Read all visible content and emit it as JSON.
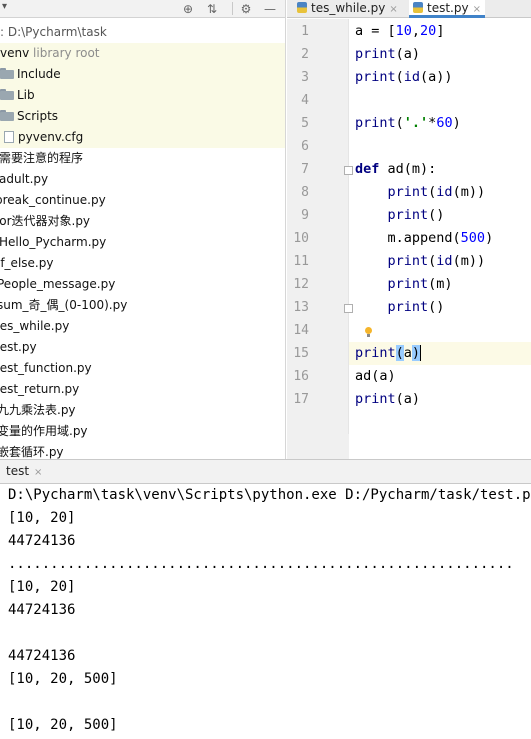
{
  "project": {
    "toolbar": {
      "dropdown_arrow": "▾"
    },
    "tree": [
      {
        "text": "D:\\Pycharm\\task",
        "kind": "path"
      },
      {
        "text": "venv",
        "muted": "library root",
        "kind": "venv"
      },
      {
        "text": "Include",
        "kind": "folder"
      },
      {
        "text": "Lib",
        "kind": "folder"
      },
      {
        "text": "Scripts",
        "kind": "folder"
      },
      {
        "text": "pyvenv.cfg",
        "kind": "file"
      },
      {
        "text": "需要注意的程序",
        "kind": "item"
      },
      {
        "text": "adult.py",
        "kind": "item"
      },
      {
        "text": "break_continue.py",
        "kind": "item"
      },
      {
        "text": "for迭代器对象.py",
        "kind": "item"
      },
      {
        "text": "Hello_Pycharm.py",
        "kind": "item"
      },
      {
        "text": "if_else.py",
        "kind": "item"
      },
      {
        "text": "People_message.py",
        "kind": "item"
      },
      {
        "text": "sum_奇_偶_(0-100).py",
        "kind": "item"
      },
      {
        "text": "tes_while.py",
        "kind": "item"
      },
      {
        "text": "test.py",
        "kind": "item"
      },
      {
        "text": "test_function.py",
        "kind": "item"
      },
      {
        "text": "test_return.py",
        "kind": "item"
      },
      {
        "text": "九九乘法表.py",
        "kind": "item"
      },
      {
        "text": "变量的作用域.py",
        "kind": "item"
      },
      {
        "text": "嵌套循环.py",
        "kind": "item"
      }
    ]
  },
  "editor": {
    "tabs": [
      {
        "label": "tes_while.py",
        "close": "×"
      },
      {
        "label": "test.py",
        "close": "×"
      }
    ],
    "line_numbers": [
      "1",
      "2",
      "3",
      "4",
      "5",
      "6",
      "7",
      "8",
      "9",
      "10",
      "11",
      "12",
      "13",
      "14",
      "15",
      "16",
      "17"
    ]
  },
  "run": {
    "tab_label": "test",
    "tab_close": "×",
    "output": [
      "D:\\Pycharm\\task\\venv\\Scripts\\python.exe D:/Pycharm/task/test.py",
      "[10, 20]",
      "44724136",
      "............................................................",
      "[10, 20]",
      "44724136",
      "",
      "44724136",
      "[10, 20, 500]",
      "",
      "[10, 20, 500]"
    ]
  }
}
